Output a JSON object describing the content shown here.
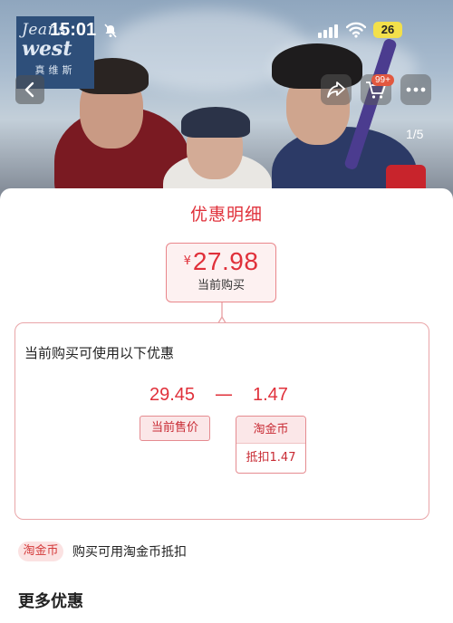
{
  "status_bar": {
    "time": "15:01",
    "battery": "26"
  },
  "banner": {
    "brand_line1": "Jeans",
    "brand_line2": "west",
    "brand_line3": "真维斯",
    "cart_badge": "99+",
    "page_indicator": "1/5"
  },
  "sheet": {
    "title": "优惠明细",
    "price": {
      "currency": "¥",
      "value": "27.98",
      "caption": "当前购买"
    },
    "detail": {
      "heading": "当前购买可使用以下优惠",
      "base_price": "29.45",
      "operator": "—",
      "discount_value": "1.47",
      "base_price_label": "当前售价",
      "coin_label": "淘金币",
      "coin_deduct": "抵扣1.47"
    },
    "coin_row": {
      "badge": "淘金币",
      "description": "购买可用淘金币抵扣"
    },
    "more_title": "更多优惠"
  },
  "colors": {
    "accent": "#e0303a",
    "tag_bg": "#fbe7e8",
    "border": "#e9a5a8"
  },
  "icons": [
    "bell-slash-icon",
    "signal-icon",
    "wifi-icon",
    "back-arrow-icon",
    "share-icon",
    "cart-icon",
    "more-dots-icon"
  ]
}
